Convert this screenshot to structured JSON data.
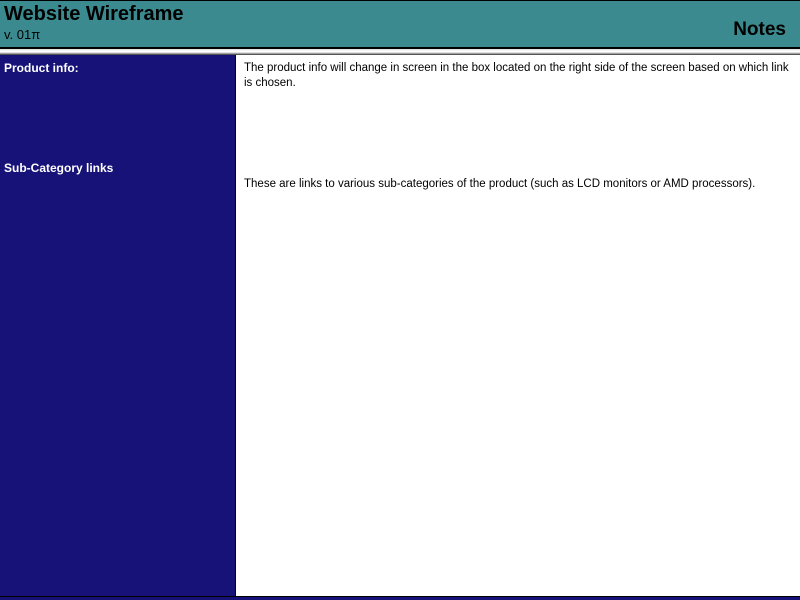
{
  "header": {
    "title": "Website Wireframe",
    "version": "v. 01π",
    "notes_label": "Notes"
  },
  "sidebar": {
    "items": [
      {
        "label": "Product info:"
      },
      {
        "label": "Sub-Category links"
      }
    ]
  },
  "content": {
    "blocks": [
      {
        "text": "The product info will change in screen in the box located on the right side of the screen based on which link is chosen."
      },
      {
        "text": "These are links to various sub-categories of the product (such as LCD monitors or AMD processors)."
      }
    ]
  }
}
